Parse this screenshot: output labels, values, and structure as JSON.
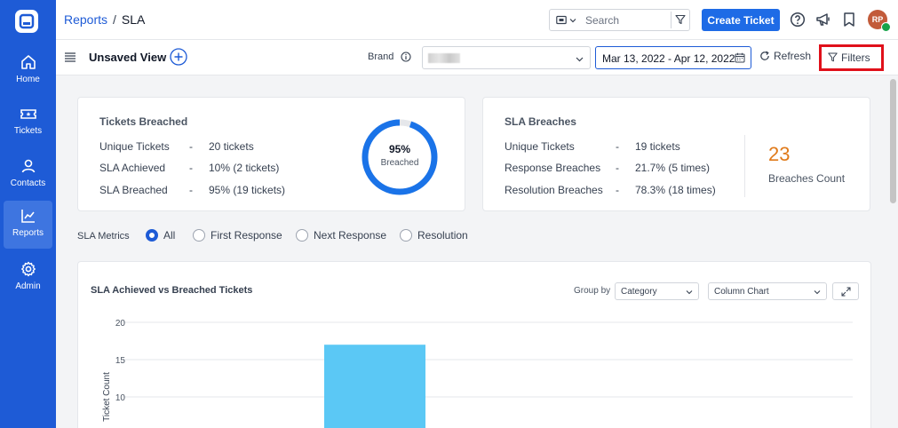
{
  "sidebar": {
    "items": [
      {
        "label": "Home",
        "icon": "home-icon"
      },
      {
        "label": "Tickets",
        "icon": "ticket-icon"
      },
      {
        "label": "Contacts",
        "icon": "user-icon"
      },
      {
        "label": "Reports",
        "icon": "chart-icon",
        "active": true
      },
      {
        "label": "Admin",
        "icon": "gear-icon"
      }
    ]
  },
  "header": {
    "breadcrumb_parent": "Reports",
    "breadcrumb_sep": "/",
    "breadcrumb_current": "SLA",
    "search_placeholder": "Search",
    "create_label": "Create Ticket",
    "avatar_initials": "RP"
  },
  "toolbar": {
    "view_title": "Unsaved View",
    "brand_label": "Brand",
    "date_range": "Mar 13, 2022 - Apr 12, 2022",
    "refresh_label": "Refresh",
    "filters_label": "Filters"
  },
  "tickets_breached": {
    "title": "Tickets Breached",
    "rows": [
      {
        "label": "Unique Tickets",
        "dash": "-",
        "value": "20 tickets"
      },
      {
        "label": "SLA Achieved",
        "dash": "-",
        "value": "10% (2 tickets)"
      },
      {
        "label": "SLA Breached",
        "dash": "-",
        "value": "95% (19 tickets)"
      }
    ],
    "donut_percent_text": "95%",
    "donut_label": "Breached",
    "donut_fraction": 0.95
  },
  "sla_breaches": {
    "title": "SLA Breaches",
    "rows": [
      {
        "label": "Unique Tickets",
        "dash": "-",
        "value": "19 tickets"
      },
      {
        "label": "Response Breaches",
        "dash": "-",
        "value": "21.7% (5 times)"
      },
      {
        "label": "Resolution Breaches",
        "dash": "-",
        "value": "78.3% (18 times)"
      }
    ],
    "count": "23",
    "count_label": "Breaches Count"
  },
  "metrics": {
    "label": "SLA Metrics",
    "options": [
      "All",
      "First Response",
      "Next Response",
      "Resolution"
    ],
    "selected": "All"
  },
  "chart_panel": {
    "title": "SLA Achieved vs Breached Tickets",
    "group_by_label": "Group by",
    "group_by_value": "Category",
    "chart_type_value": "Column Chart"
  },
  "colors": {
    "sidebar": "#1e5bd6",
    "accent": "#1e6be6",
    "donut_ring": "#1a73e8",
    "bar": "#5bc8f5",
    "count": "#e07a1a",
    "highlight": "#e0101a"
  },
  "chart_data": {
    "type": "bar",
    "ylabel": "Ticket Count",
    "yticks": [
      10,
      15,
      20
    ],
    "ylim": [
      0,
      20
    ],
    "bars": [
      {
        "value": 17
      }
    ],
    "grid": true
  }
}
